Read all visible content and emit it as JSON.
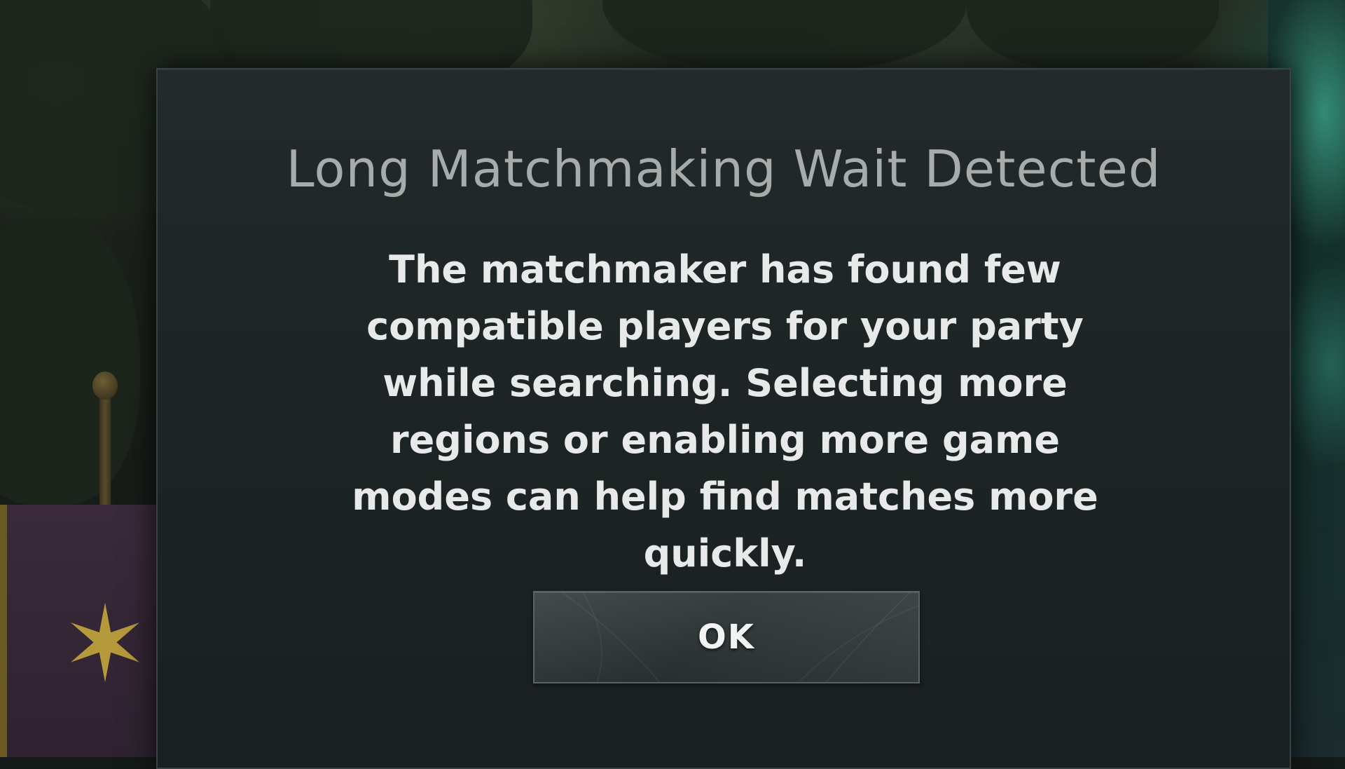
{
  "background": {
    "banner_emblem": "✶"
  },
  "dialog": {
    "title": "Long Matchmaking Wait Detected",
    "message": "The matchmaker has found few compatible players for your party while searching. Selecting more regions or enabling more game modes can help find matches more quickly.",
    "ok_label": "OK"
  }
}
